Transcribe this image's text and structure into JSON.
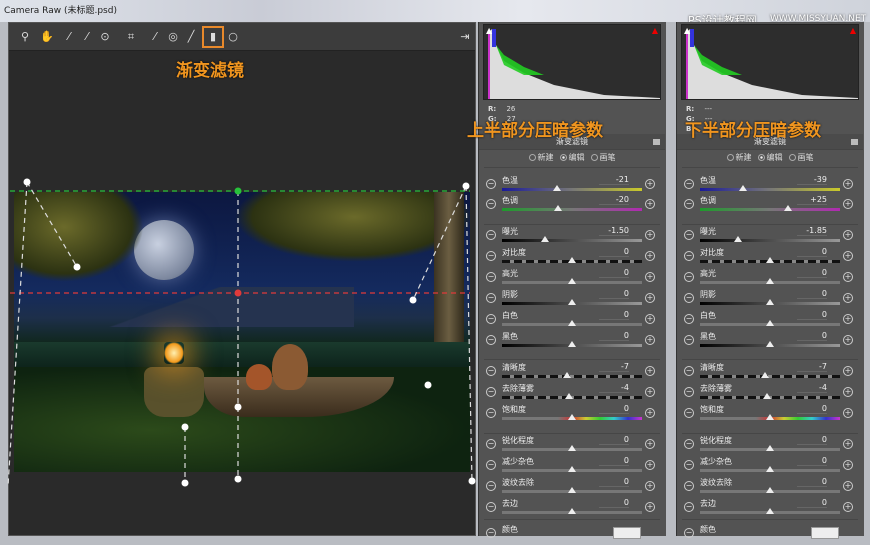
{
  "window": {
    "title": "Camera Raw (未标题.psd)"
  },
  "watermark": {
    "left": "PS设计教程网",
    "right": "WWW.MISSYUAN.NET"
  },
  "toolbar": {
    "tools": [
      {
        "name": "zoom-tool-icon",
        "glyph": "⚲"
      },
      {
        "name": "hand-tool-icon",
        "glyph": "✋"
      },
      {
        "name": "white-balance-icon",
        "glyph": "⁄"
      },
      {
        "name": "color-sampler-icon",
        "glyph": "⁄"
      },
      {
        "name": "targeted-adjust-icon",
        "glyph": "⊙"
      },
      {
        "name": "crop-icon",
        "glyph": "⌗"
      },
      {
        "name": "spot-removal-icon",
        "glyph": "⁄"
      },
      {
        "name": "red-eye-icon",
        "glyph": "◎"
      },
      {
        "name": "adjustment-brush-icon",
        "glyph": "╱"
      },
      {
        "name": "graduated-filter-icon",
        "glyph": "▮"
      },
      {
        "name": "radial-filter-icon",
        "glyph": "○"
      }
    ],
    "export_glyph": "⇥",
    "annotation": "渐变滤镜"
  },
  "panels": [
    {
      "annotation": "上半部分压暗参数",
      "rgb": {
        "r": "R:",
        "r_val": "26",
        "g": "G:",
        "g_val": "27",
        "b": "B:",
        "b_val": "15"
      },
      "title": "渐变滤镜",
      "modes": [
        "新建",
        "编辑",
        "画笔"
      ],
      "selected_mode": "编辑",
      "sliders": [
        {
          "label": "色温",
          "value": "-21",
          "pos": 0.395,
          "track": "temp"
        },
        {
          "label": "色调",
          "value": "-20",
          "pos": 0.4,
          "track": "tint"
        },
        {
          "label": "曝光",
          "value": "-1.50",
          "pos": 0.31,
          "track": "dark"
        },
        {
          "label": "对比度",
          "value": "0",
          "pos": 0.5,
          "track": "dash"
        },
        {
          "label": "高光",
          "value": "0",
          "pos": 0.5,
          "track": "plain"
        },
        {
          "label": "阴影",
          "value": "0",
          "pos": 0.5,
          "track": "dark"
        },
        {
          "label": "白色",
          "value": "0",
          "pos": 0.5,
          "track": "plain"
        },
        {
          "label": "黑色",
          "value": "0",
          "pos": 0.5,
          "track": "dark"
        },
        {
          "label": "清晰度",
          "value": "-7",
          "pos": 0.465,
          "track": "dash"
        },
        {
          "label": "去除薄雾",
          "value": "-4",
          "pos": 0.48,
          "track": "dash"
        },
        {
          "label": "饱和度",
          "value": "0",
          "pos": 0.5,
          "track": "sat"
        },
        {
          "label": "锐化程度",
          "value": "0",
          "pos": 0.5,
          "track": "plain"
        },
        {
          "label": "减少杂色",
          "value": "0",
          "pos": 0.5,
          "track": "plain"
        },
        {
          "label": "波纹去除",
          "value": "0",
          "pos": 0.5,
          "track": "plain"
        },
        {
          "label": "去边",
          "value": "0",
          "pos": 0.5,
          "track": "plain"
        }
      ],
      "color_label": "颜色"
    },
    {
      "annotation": "下半部分压暗参数",
      "rgb": {
        "r": "R:",
        "r_val": "---",
        "g": "G:",
        "g_val": "---",
        "b": "B:",
        "b_val": "---"
      },
      "title": "渐变滤镜",
      "modes": [
        "新建",
        "编辑",
        "画笔"
      ],
      "selected_mode": "编辑",
      "sliders": [
        {
          "label": "色温",
          "value": "-39",
          "pos": 0.305,
          "track": "temp"
        },
        {
          "label": "色调",
          "value": "+25",
          "pos": 0.625,
          "track": "tint"
        },
        {
          "label": "曝光",
          "value": "-1.85",
          "pos": 0.27,
          "track": "dark"
        },
        {
          "label": "对比度",
          "value": "0",
          "pos": 0.5,
          "track": "dash"
        },
        {
          "label": "高光",
          "value": "0",
          "pos": 0.5,
          "track": "plain"
        },
        {
          "label": "阴影",
          "value": "0",
          "pos": 0.5,
          "track": "dark"
        },
        {
          "label": "白色",
          "value": "0",
          "pos": 0.5,
          "track": "plain"
        },
        {
          "label": "黑色",
          "value": "0",
          "pos": 0.5,
          "track": "dark"
        },
        {
          "label": "清晰度",
          "value": "-7",
          "pos": 0.465,
          "track": "dash"
        },
        {
          "label": "去除薄雾",
          "value": "-4",
          "pos": 0.48,
          "track": "dash"
        },
        {
          "label": "饱和度",
          "value": "0",
          "pos": 0.5,
          "track": "sat"
        },
        {
          "label": "锐化程度",
          "value": "0",
          "pos": 0.5,
          "track": "plain"
        },
        {
          "label": "减少杂色",
          "value": "0",
          "pos": 0.5,
          "track": "plain"
        },
        {
          "label": "波纹去除",
          "value": "0",
          "pos": 0.5,
          "track": "plain"
        },
        {
          "label": "去边",
          "value": "0",
          "pos": 0.5,
          "track": "plain"
        }
      ],
      "color_label": "颜色"
    }
  ],
  "colors": {
    "accent": "#f0951f",
    "start_line": "#27c13b",
    "end_line": "#e03a3a"
  }
}
